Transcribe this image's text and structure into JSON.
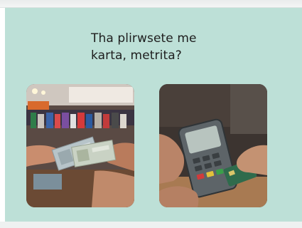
{
  "question": {
    "line1": "Tha plirwsete me",
    "line2": "karta, metrita?"
  },
  "options": [
    {
      "id": "cash",
      "icon": "cash-payment-photo"
    },
    {
      "id": "card",
      "icon": "card-payment-photo"
    }
  ],
  "colors": {
    "card_background": "#bde0d7",
    "text": "#1e1e1e"
  }
}
